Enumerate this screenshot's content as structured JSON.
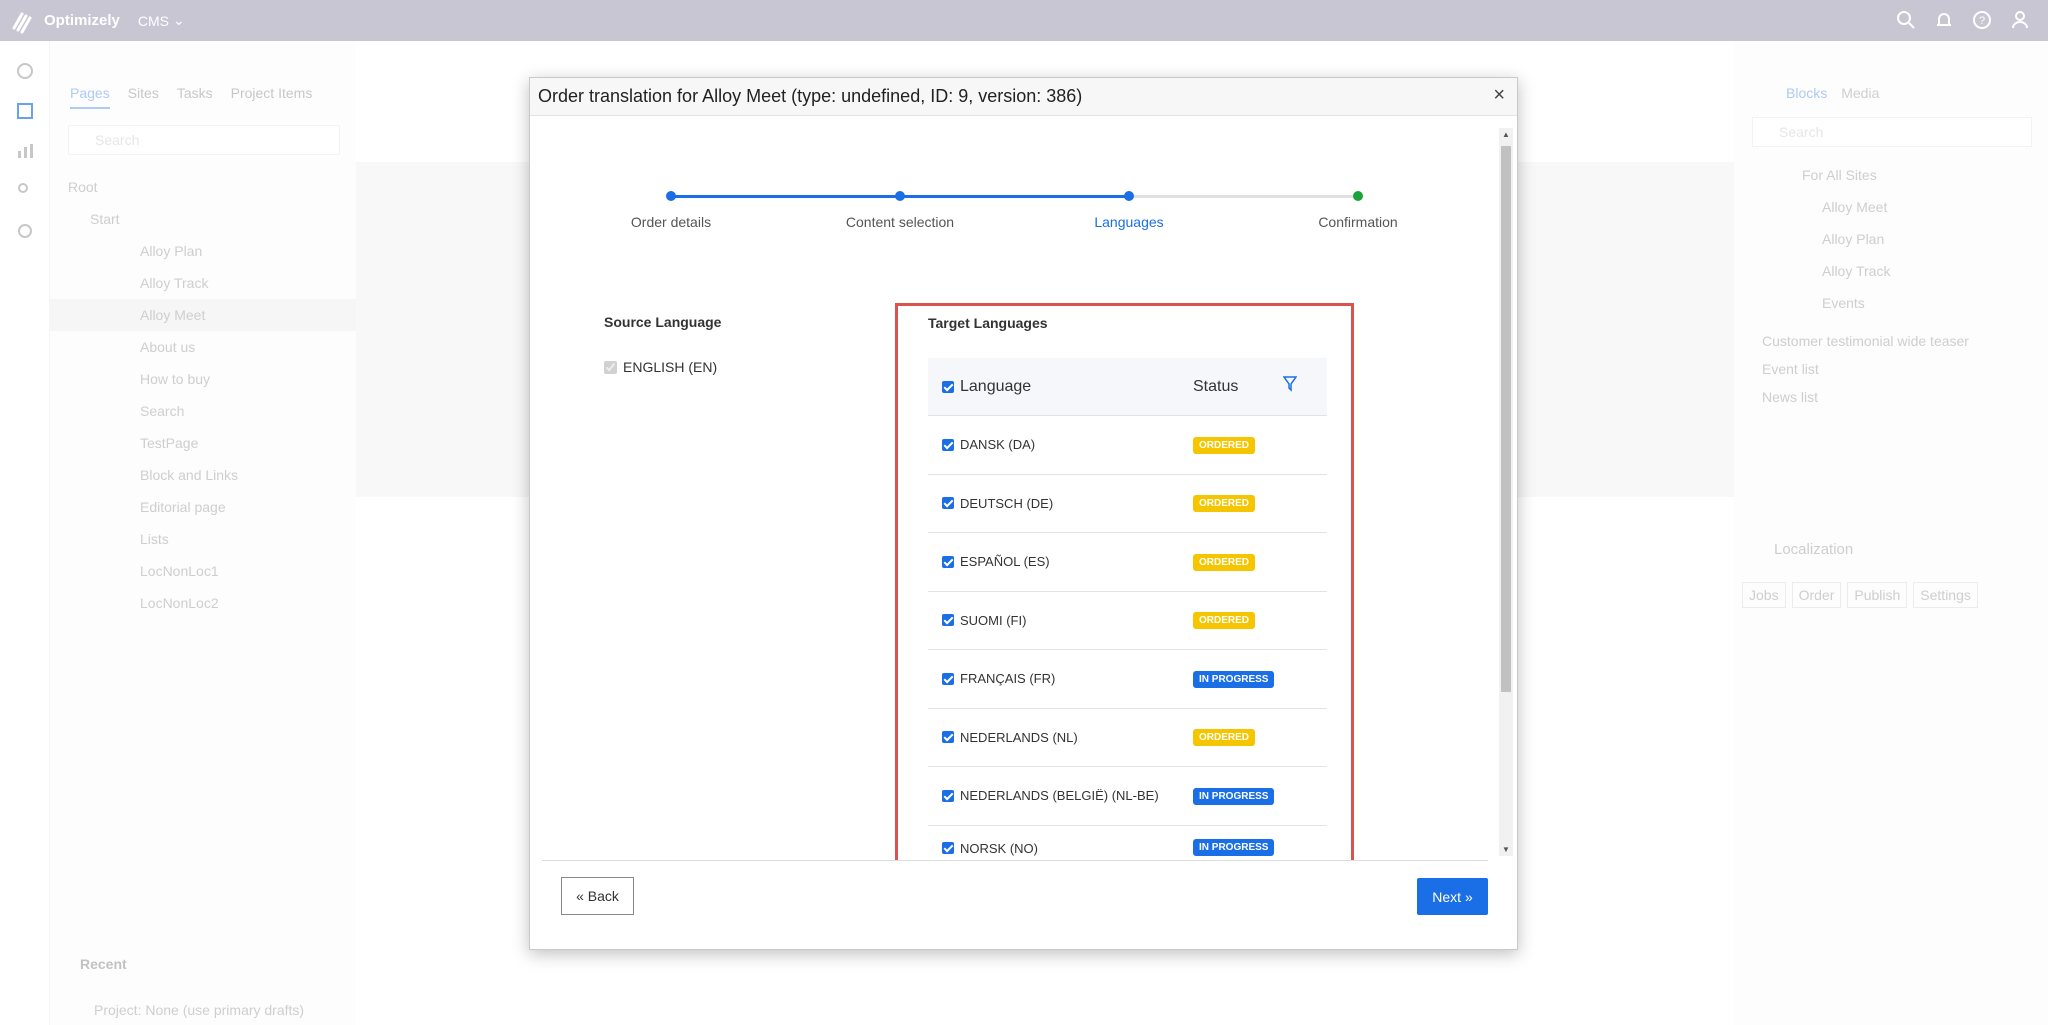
{
  "topbar": {
    "brand": "Optimizely",
    "product": "CMS"
  },
  "left_panel": {
    "tabs": [
      "Pages",
      "Sites",
      "Tasks",
      "Project Items"
    ],
    "search_placeholder": "Search",
    "tree": [
      "Root",
      "Start",
      "Alloy Plan",
      "Alloy Track",
      "Alloy Meet",
      "About us",
      "How to buy",
      "Search",
      "TestPage",
      "Block and Links",
      "Editorial page",
      "Lists",
      "LocNonLoc1",
      "LocNonLoc2"
    ],
    "recent": "Recent",
    "project": "Project:",
    "project_value": "None (use primary drafts)"
  },
  "right_panel": {
    "tabs": [
      "Blocks",
      "Media"
    ],
    "search_placeholder": "Search",
    "folder": "For All Sites",
    "items": [
      "Alloy Meet",
      "Alloy Plan",
      "Alloy Track",
      "Events"
    ],
    "blocks": [
      "Customer testimonial wide teaser",
      "Event list",
      "News list"
    ],
    "localization": "Localization",
    "loc_buttons": [
      "Jobs",
      "Order",
      "Publish",
      "Settings"
    ]
  },
  "dialog": {
    "title": "Order translation for Alloy Meet (type: undefined, ID: 9, version: 386)",
    "steps": [
      {
        "label": "Order details"
      },
      {
        "label": "Content selection"
      },
      {
        "label": "Languages"
      },
      {
        "label": "Confirmation"
      }
    ],
    "source_title": "Source Language",
    "source_item": "ENGLISH (EN)",
    "target_title": "Target Languages",
    "col_language": "Language",
    "col_status": "Status",
    "rows": [
      {
        "lang": "DANSK (DA)",
        "status": "ORDERED"
      },
      {
        "lang": "DEUTSCH (DE)",
        "status": "ORDERED"
      },
      {
        "lang": "ESPAÑOL (ES)",
        "status": "ORDERED"
      },
      {
        "lang": "SUOMI (FI)",
        "status": "ORDERED"
      },
      {
        "lang": "FRANÇAIS (FR)",
        "status": "IN PROGRESS"
      },
      {
        "lang": "NEDERLANDS (NL)",
        "status": "ORDERED"
      },
      {
        "lang": "NEDERLANDS (BELGIË) (NL-BE)",
        "status": "IN PROGRESS"
      },
      {
        "lang": "NORSK (NO)",
        "status": "IN PROGRESS"
      }
    ],
    "back_label": "« Back",
    "next_label": "Next »"
  },
  "colors": {
    "accent": "#1a6ee6",
    "ordered": "#f5c500",
    "highlight": "#d9534f",
    "success": "#1aa33a"
  }
}
